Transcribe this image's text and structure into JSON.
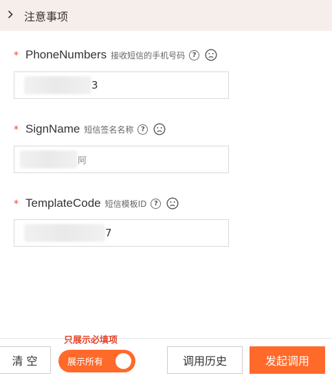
{
  "notice": {
    "title": "注意事项",
    "icon": "chevron-right-icon"
  },
  "fields": [
    {
      "name": "PhoneNumbers",
      "desc": "接收短信的手机号码",
      "value_tail": "3",
      "required_mark": "*"
    },
    {
      "name": "SignName",
      "desc": "短信签名名称",
      "value_tail": "阿",
      "required_mark": "*"
    },
    {
      "name": "TemplateCode",
      "desc": "短信模板ID",
      "value_tail": "7",
      "required_mark": "*"
    }
  ],
  "footer": {
    "only_required_label": "只展示必填项",
    "clear_label": "清 空",
    "toggle_label": "展示所有",
    "history_label": "调用历史",
    "invoke_label": "发起调用"
  },
  "colors": {
    "accent": "#ff6a2a",
    "required": "#e8432b",
    "notice_bg": "#f6eeea"
  }
}
